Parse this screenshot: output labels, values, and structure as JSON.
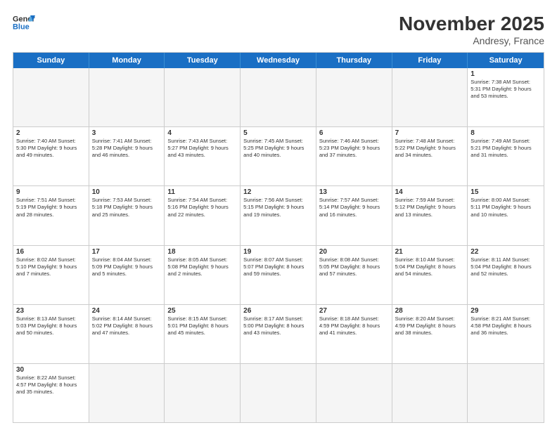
{
  "header": {
    "logo_general": "General",
    "logo_blue": "Blue",
    "month_title": "November 2025",
    "location": "Andresy, France"
  },
  "days_of_week": [
    "Sunday",
    "Monday",
    "Tuesday",
    "Wednesday",
    "Thursday",
    "Friday",
    "Saturday"
  ],
  "weeks": [
    [
      {
        "day": "",
        "empty": true,
        "info": ""
      },
      {
        "day": "",
        "empty": true,
        "info": ""
      },
      {
        "day": "",
        "empty": true,
        "info": ""
      },
      {
        "day": "",
        "empty": true,
        "info": ""
      },
      {
        "day": "",
        "empty": true,
        "info": ""
      },
      {
        "day": "",
        "empty": true,
        "info": ""
      },
      {
        "day": "1",
        "empty": false,
        "info": "Sunrise: 7:38 AM\nSunset: 5:31 PM\nDaylight: 9 hours\nand 53 minutes."
      }
    ],
    [
      {
        "day": "2",
        "empty": false,
        "info": "Sunrise: 7:40 AM\nSunset: 5:30 PM\nDaylight: 9 hours\nand 49 minutes."
      },
      {
        "day": "3",
        "empty": false,
        "info": "Sunrise: 7:41 AM\nSunset: 5:28 PM\nDaylight: 9 hours\nand 46 minutes."
      },
      {
        "day": "4",
        "empty": false,
        "info": "Sunrise: 7:43 AM\nSunset: 5:27 PM\nDaylight: 9 hours\nand 43 minutes."
      },
      {
        "day": "5",
        "empty": false,
        "info": "Sunrise: 7:45 AM\nSunset: 5:25 PM\nDaylight: 9 hours\nand 40 minutes."
      },
      {
        "day": "6",
        "empty": false,
        "info": "Sunrise: 7:46 AM\nSunset: 5:23 PM\nDaylight: 9 hours\nand 37 minutes."
      },
      {
        "day": "7",
        "empty": false,
        "info": "Sunrise: 7:48 AM\nSunset: 5:22 PM\nDaylight: 9 hours\nand 34 minutes."
      },
      {
        "day": "8",
        "empty": false,
        "info": "Sunrise: 7:49 AM\nSunset: 5:21 PM\nDaylight: 9 hours\nand 31 minutes."
      }
    ],
    [
      {
        "day": "9",
        "empty": false,
        "info": "Sunrise: 7:51 AM\nSunset: 5:19 PM\nDaylight: 9 hours\nand 28 minutes."
      },
      {
        "day": "10",
        "empty": false,
        "info": "Sunrise: 7:53 AM\nSunset: 5:18 PM\nDaylight: 9 hours\nand 25 minutes."
      },
      {
        "day": "11",
        "empty": false,
        "info": "Sunrise: 7:54 AM\nSunset: 5:16 PM\nDaylight: 9 hours\nand 22 minutes."
      },
      {
        "day": "12",
        "empty": false,
        "info": "Sunrise: 7:56 AM\nSunset: 5:15 PM\nDaylight: 9 hours\nand 19 minutes."
      },
      {
        "day": "13",
        "empty": false,
        "info": "Sunrise: 7:57 AM\nSunset: 5:14 PM\nDaylight: 9 hours\nand 16 minutes."
      },
      {
        "day": "14",
        "empty": false,
        "info": "Sunrise: 7:59 AM\nSunset: 5:12 PM\nDaylight: 9 hours\nand 13 minutes."
      },
      {
        "day": "15",
        "empty": false,
        "info": "Sunrise: 8:00 AM\nSunset: 5:11 PM\nDaylight: 9 hours\nand 10 minutes."
      }
    ],
    [
      {
        "day": "16",
        "empty": false,
        "info": "Sunrise: 8:02 AM\nSunset: 5:10 PM\nDaylight: 9 hours\nand 7 minutes."
      },
      {
        "day": "17",
        "empty": false,
        "info": "Sunrise: 8:04 AM\nSunset: 5:09 PM\nDaylight: 9 hours\nand 5 minutes."
      },
      {
        "day": "18",
        "empty": false,
        "info": "Sunrise: 8:05 AM\nSunset: 5:08 PM\nDaylight: 9 hours\nand 2 minutes."
      },
      {
        "day": "19",
        "empty": false,
        "info": "Sunrise: 8:07 AM\nSunset: 5:07 PM\nDaylight: 8 hours\nand 59 minutes."
      },
      {
        "day": "20",
        "empty": false,
        "info": "Sunrise: 8:08 AM\nSunset: 5:05 PM\nDaylight: 8 hours\nand 57 minutes."
      },
      {
        "day": "21",
        "empty": false,
        "info": "Sunrise: 8:10 AM\nSunset: 5:04 PM\nDaylight: 8 hours\nand 54 minutes."
      },
      {
        "day": "22",
        "empty": false,
        "info": "Sunrise: 8:11 AM\nSunset: 5:04 PM\nDaylight: 8 hours\nand 52 minutes."
      }
    ],
    [
      {
        "day": "23",
        "empty": false,
        "info": "Sunrise: 8:13 AM\nSunset: 5:03 PM\nDaylight: 8 hours\nand 50 minutes."
      },
      {
        "day": "24",
        "empty": false,
        "info": "Sunrise: 8:14 AM\nSunset: 5:02 PM\nDaylight: 8 hours\nand 47 minutes."
      },
      {
        "day": "25",
        "empty": false,
        "info": "Sunrise: 8:15 AM\nSunset: 5:01 PM\nDaylight: 8 hours\nand 45 minutes."
      },
      {
        "day": "26",
        "empty": false,
        "info": "Sunrise: 8:17 AM\nSunset: 5:00 PM\nDaylight: 8 hours\nand 43 minutes."
      },
      {
        "day": "27",
        "empty": false,
        "info": "Sunrise: 8:18 AM\nSunset: 4:59 PM\nDaylight: 8 hours\nand 41 minutes."
      },
      {
        "day": "28",
        "empty": false,
        "info": "Sunrise: 8:20 AM\nSunset: 4:59 PM\nDaylight: 8 hours\nand 38 minutes."
      },
      {
        "day": "29",
        "empty": false,
        "info": "Sunrise: 8:21 AM\nSunset: 4:58 PM\nDaylight: 8 hours\nand 36 minutes."
      }
    ],
    [
      {
        "day": "30",
        "empty": false,
        "info": "Sunrise: 8:22 AM\nSunset: 4:57 PM\nDaylight: 8 hours\nand 35 minutes."
      },
      {
        "day": "",
        "empty": true,
        "info": ""
      },
      {
        "day": "",
        "empty": true,
        "info": ""
      },
      {
        "day": "",
        "empty": true,
        "info": ""
      },
      {
        "day": "",
        "empty": true,
        "info": ""
      },
      {
        "day": "",
        "empty": true,
        "info": ""
      },
      {
        "day": "",
        "empty": true,
        "info": ""
      }
    ]
  ]
}
